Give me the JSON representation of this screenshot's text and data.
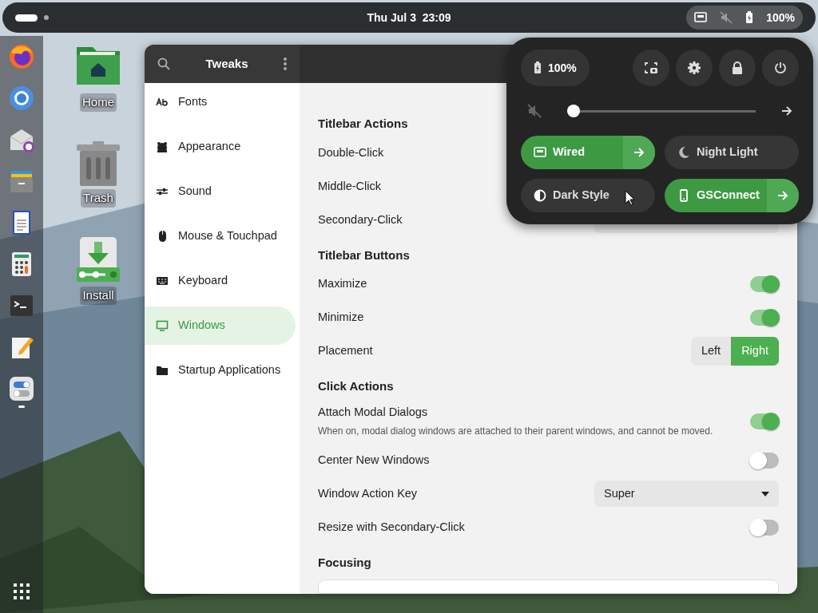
{
  "top_bar": {
    "clock": "Thu Jul 3  23:09",
    "battery": "100%",
    "muted": true
  },
  "dock": [
    {
      "kind": "firefox",
      "running": false
    },
    {
      "kind": "chrome",
      "running": false
    },
    {
      "kind": "mail",
      "running": false
    },
    {
      "kind": "cabinet",
      "running": false
    },
    {
      "kind": "document",
      "running": false
    },
    {
      "kind": "calculator",
      "running": false
    },
    {
      "kind": "terminal",
      "running": false
    },
    {
      "kind": "notepad",
      "running": false
    },
    {
      "kind": "tweaks",
      "running": true
    }
  ],
  "desktop_icons": [
    {
      "kind": "home",
      "label": "Home"
    },
    {
      "kind": "trash",
      "label": "Trash"
    },
    {
      "kind": "install",
      "label": "Install"
    }
  ],
  "window": {
    "title": "Tweaks",
    "sidebar": [
      {
        "kind": "fonts",
        "label": "Fonts",
        "selected": false
      },
      {
        "kind": "appearance",
        "label": "Appearance",
        "selected": false
      },
      {
        "kind": "sound",
        "label": "Sound",
        "selected": false
      },
      {
        "kind": "mouse",
        "label": "Mouse & Touchpad",
        "selected": false
      },
      {
        "kind": "keyboard",
        "label": "Keyboard",
        "selected": false
      },
      {
        "kind": "windows",
        "label": "Windows",
        "selected": true
      },
      {
        "kind": "startup",
        "label": "Startup Applications",
        "selected": false
      }
    ],
    "sections": [
      {
        "title": "Titlebar Actions",
        "rows": [
          {
            "kind": "plain",
            "label": "Double-Click"
          },
          {
            "kind": "plain",
            "label": "Middle-Click"
          },
          {
            "kind": "dropdown",
            "label": "Secondary-Click"
          }
        ]
      },
      {
        "title": "Titlebar Buttons",
        "rows": [
          {
            "kind": "switch",
            "label": "Maximize",
            "on": true
          },
          {
            "kind": "switch",
            "label": "Minimize",
            "on": true
          },
          {
            "kind": "segmented",
            "label": "Placement",
            "options": [
              {
                "label": "Left",
                "selected": false
              },
              {
                "label": "Right",
                "selected": true
              }
            ]
          }
        ]
      },
      {
        "title": "Click Actions",
        "rows": [
          {
            "kind": "switch",
            "label": "Attach Modal Dialogs",
            "description": "When on, modal dialog windows are attached to their parent windows, and cannot be moved.",
            "on": true
          },
          {
            "kind": "switch",
            "label": "Center New Windows",
            "on": false
          },
          {
            "kind": "dropdown",
            "label": "Window Action Key",
            "value": "Super"
          },
          {
            "kind": "switch",
            "label": "Resize with Secondary-Click",
            "on": false
          }
        ]
      },
      {
        "title": "Focusing",
        "rows": [
          {
            "kind": "box"
          }
        ]
      }
    ]
  },
  "quick_settings": {
    "battery": "100%",
    "volume": {
      "muted": true,
      "level": 0.0
    },
    "tiles": [
      {
        "kind": "wired",
        "label": "Wired",
        "on": true,
        "arrow": true
      },
      {
        "kind": "night",
        "label": "Night Light",
        "on": false,
        "arrow": false
      },
      {
        "kind": "dark",
        "label": "Dark Style",
        "on": false,
        "arrow": false
      },
      {
        "kind": "phone",
        "label": "GSConnect",
        "on": true,
        "arrow": true
      }
    ]
  }
}
